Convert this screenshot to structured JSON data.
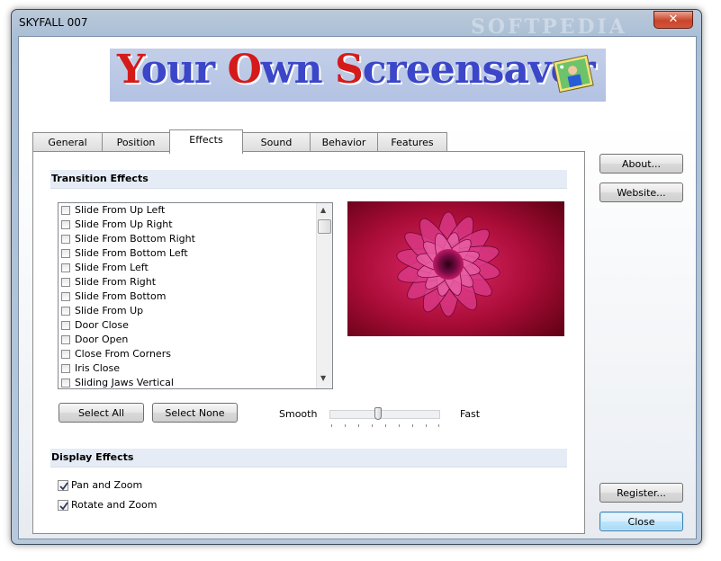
{
  "window": {
    "title": "SKYFALL 007",
    "watermark": "SOFTPEDIA",
    "close_glyph": "✕"
  },
  "banner": {
    "word1_initial": "Y",
    "word1_rest": "our ",
    "word2_initial": "O",
    "word2_rest": "wn ",
    "word3_initial": "S",
    "word3_rest": "creensaver"
  },
  "tabs": [
    {
      "label": "General",
      "active": false
    },
    {
      "label": "Position",
      "active": false
    },
    {
      "label": "Effects",
      "active": true
    },
    {
      "label": "Sound",
      "active": false
    },
    {
      "label": "Behavior",
      "active": false
    },
    {
      "label": "Features",
      "active": false
    }
  ],
  "transition": {
    "heading": "Transition Effects",
    "items": [
      {
        "label": "Slide From Up Left",
        "checked": false
      },
      {
        "label": "Slide From Up Right",
        "checked": false
      },
      {
        "label": "Slide From Bottom Right",
        "checked": false
      },
      {
        "label": "Slide From Bottom Left",
        "checked": false
      },
      {
        "label": "Slide From Left",
        "checked": false
      },
      {
        "label": "Slide From Right",
        "checked": false
      },
      {
        "label": "Slide From Bottom",
        "checked": false
      },
      {
        "label": "Slide From Up",
        "checked": false
      },
      {
        "label": "Door Close",
        "checked": false
      },
      {
        "label": "Door Open",
        "checked": false
      },
      {
        "label": "Close From Corners",
        "checked": false
      },
      {
        "label": "Iris Close",
        "checked": false
      },
      {
        "label": "Sliding Jaws Vertical",
        "checked": false
      }
    ],
    "select_all": "Select All",
    "select_none": "Select None",
    "speed_slow": "Smooth",
    "speed_fast": "Fast",
    "speed_level": 0.45
  },
  "display": {
    "heading": "Display Effects",
    "options": [
      {
        "label": "Pan and Zoom",
        "checked": true
      },
      {
        "label": "Rotate and Zoom",
        "checked": true
      }
    ]
  },
  "side_buttons": {
    "about": "About...",
    "website": "Website...",
    "register": "Register...",
    "close": "Close"
  },
  "colors": {
    "accent": "#3b46c9",
    "brand_red": "#d51a1a",
    "flower": "#b0124a"
  }
}
